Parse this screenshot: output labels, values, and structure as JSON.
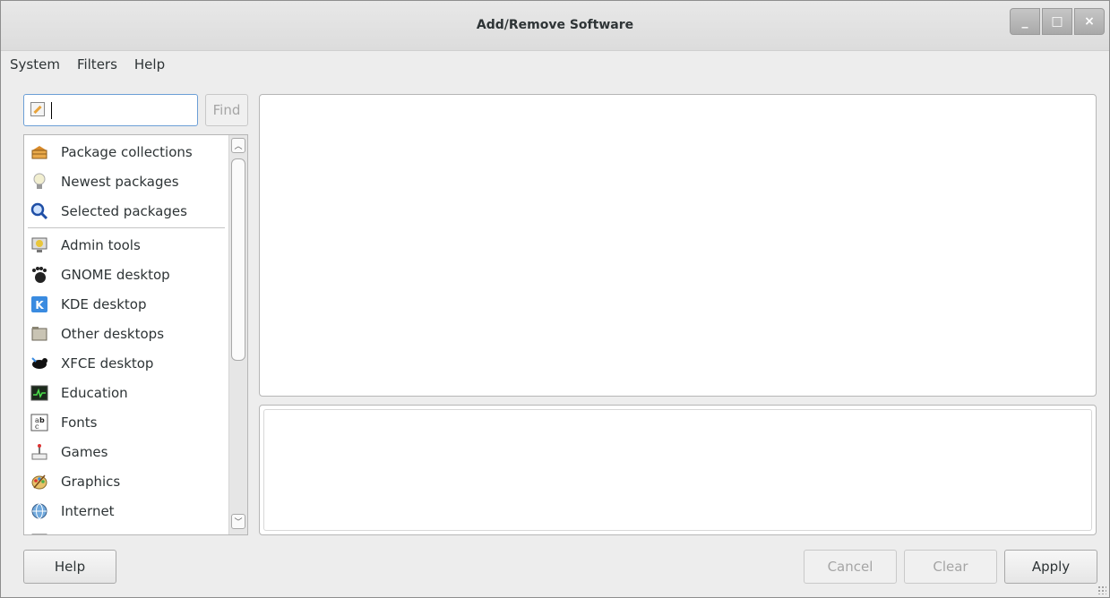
{
  "window": {
    "title": "Add/Remove Software",
    "controls": [
      "_",
      "□",
      "×"
    ]
  },
  "menu": [
    "System",
    "Filters",
    "Help"
  ],
  "search": {
    "value": "",
    "find_label": "Find"
  },
  "groups": [
    {
      "label": "Package collections",
      "icon": "package-collections-icon"
    },
    {
      "label": "Newest packages",
      "icon": "lightbulb-icon"
    },
    {
      "label": "Selected packages",
      "icon": "magnifier-icon"
    },
    {
      "label": "Admin tools",
      "icon": "admin-tools-icon"
    },
    {
      "label": "GNOME desktop",
      "icon": "gnome-foot-icon"
    },
    {
      "label": "KDE desktop",
      "icon": "kde-icon"
    },
    {
      "label": "Other desktops",
      "icon": "other-desktops-icon"
    },
    {
      "label": "XFCE desktop",
      "icon": "xfce-mouse-icon"
    },
    {
      "label": "Education",
      "icon": "education-icon"
    },
    {
      "label": "Fonts",
      "icon": "fonts-icon"
    },
    {
      "label": "Games",
      "icon": "games-icon"
    },
    {
      "label": "Graphics",
      "icon": "graphics-icon"
    },
    {
      "label": "Internet",
      "icon": "globe-icon"
    }
  ],
  "buttons": {
    "help": "Help",
    "cancel": "Cancel",
    "clear": "Clear",
    "apply": "Apply"
  }
}
